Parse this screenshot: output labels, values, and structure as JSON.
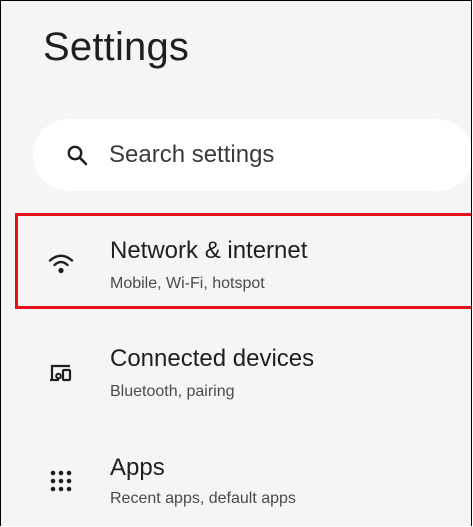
{
  "header": {
    "title": "Settings"
  },
  "search": {
    "placeholder": "Search settings",
    "icon": "search-icon"
  },
  "items": [
    {
      "title": "Network & internet",
      "subtitle": "Mobile, Wi-Fi, hotspot",
      "icon": "wifi-icon",
      "highlighted": true
    },
    {
      "title": "Connected devices",
      "subtitle": "Bluetooth, pairing",
      "icon": "connected-devices-icon",
      "highlighted": false
    },
    {
      "title": "Apps",
      "subtitle": "Recent apps, default apps",
      "icon": "apps-grid-icon",
      "highlighted": false
    }
  ],
  "colors": {
    "background": "#f5f5f5",
    "highlight_border": "#e8101a",
    "search_background": "#ffffff"
  }
}
